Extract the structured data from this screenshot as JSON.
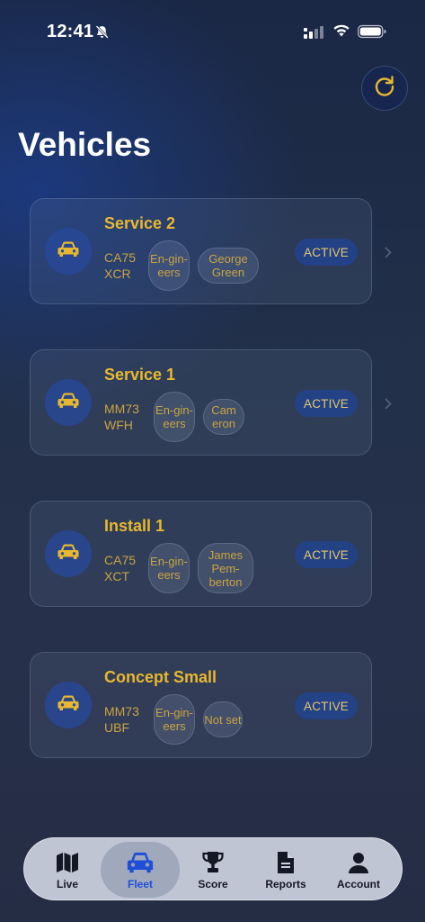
{
  "status_bar": {
    "time": "12:41",
    "icons": [
      "bell-slash-icon",
      "cellular-signal-icon",
      "wifi-icon",
      "battery-icon"
    ]
  },
  "header": {
    "title": "Vehicles",
    "refresh_icon": "refresh-icon"
  },
  "vehicles": [
    {
      "name": "Service 2",
      "plate": "CA75 XCR",
      "team": "En-gin-eers",
      "driver": "George Green",
      "status": "ACTIVE"
    },
    {
      "name": "Service 1",
      "plate": "MM73 WFH",
      "team": "En-gin-eers",
      "driver": "Cam eron",
      "status": "ACTIVE"
    },
    {
      "name": "Install 1",
      "plate": "CA75 XCT",
      "team": "En-gin-eers",
      "driver": "James Pem-berton",
      "status": "ACTIVE"
    },
    {
      "name": "Concept Small",
      "plate": "MM73 UBF",
      "team": "En-gin-eers",
      "driver": "Not set",
      "status": "ACTIVE"
    }
  ],
  "tab_bar": {
    "active": "Fleet",
    "tabs": [
      {
        "label": "Live",
        "icon": "map-icon"
      },
      {
        "label": "Fleet",
        "icon": "car-icon"
      },
      {
        "label": "Score",
        "icon": "trophy-icon"
      },
      {
        "label": "Reports",
        "icon": "document-icon"
      },
      {
        "label": "Account",
        "icon": "person-icon"
      }
    ]
  },
  "colors": {
    "accent_gold": "#e8b82e",
    "active_tab_blue": "#1f4fd8",
    "badge_blue": "#22428c"
  }
}
